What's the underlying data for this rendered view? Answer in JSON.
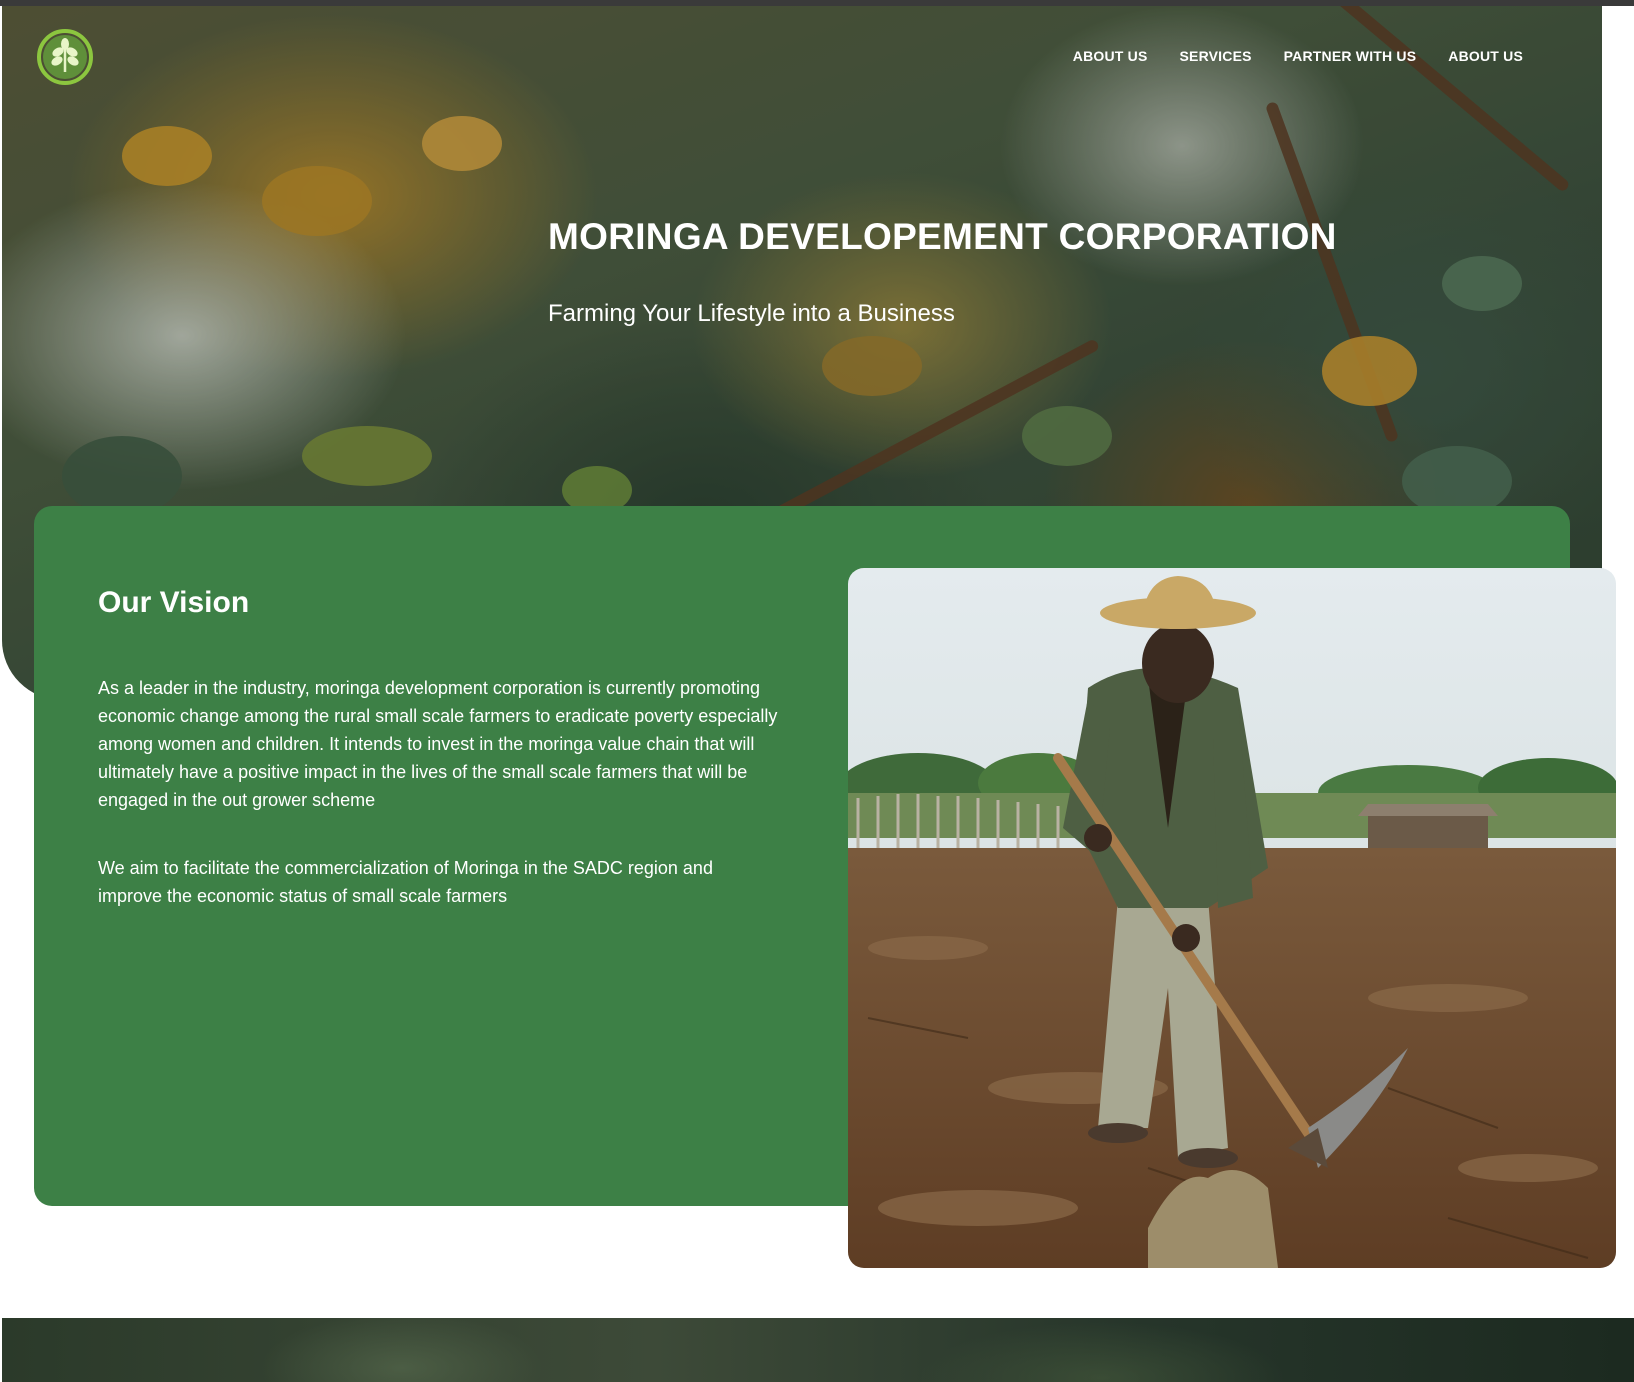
{
  "nav": {
    "items": [
      {
        "label": "ABOUT US"
      },
      {
        "label": "SERVICES"
      },
      {
        "label": "PARTNER WITH US"
      },
      {
        "label": "ABOUT US"
      }
    ]
  },
  "hero": {
    "title": "MORINGA DEVELOPEMENT CORPORATION",
    "subtitle": "Farming Your Lifestyle into a Business"
  },
  "vision": {
    "heading": "Our Vision",
    "paragraphs": [
      "As a leader in the industry, moringa development corporation is currently promoting economic change among the rural small scale farmers to eradicate poverty especially among women and children. It intends to invest in the moringa value chain that will ultimately have a positive impact in the lives of the small scale farmers that will be engaged in the out grower scheme",
      "We aim to facilitate the commercialization of Moringa in the SADC region and improve the economic status of small scale farmers"
    ]
  },
  "colors": {
    "brand_green": "#3d8046",
    "logo_green": "#8cc63f"
  },
  "icons": {
    "logo": "moringa-leaf-logo"
  }
}
